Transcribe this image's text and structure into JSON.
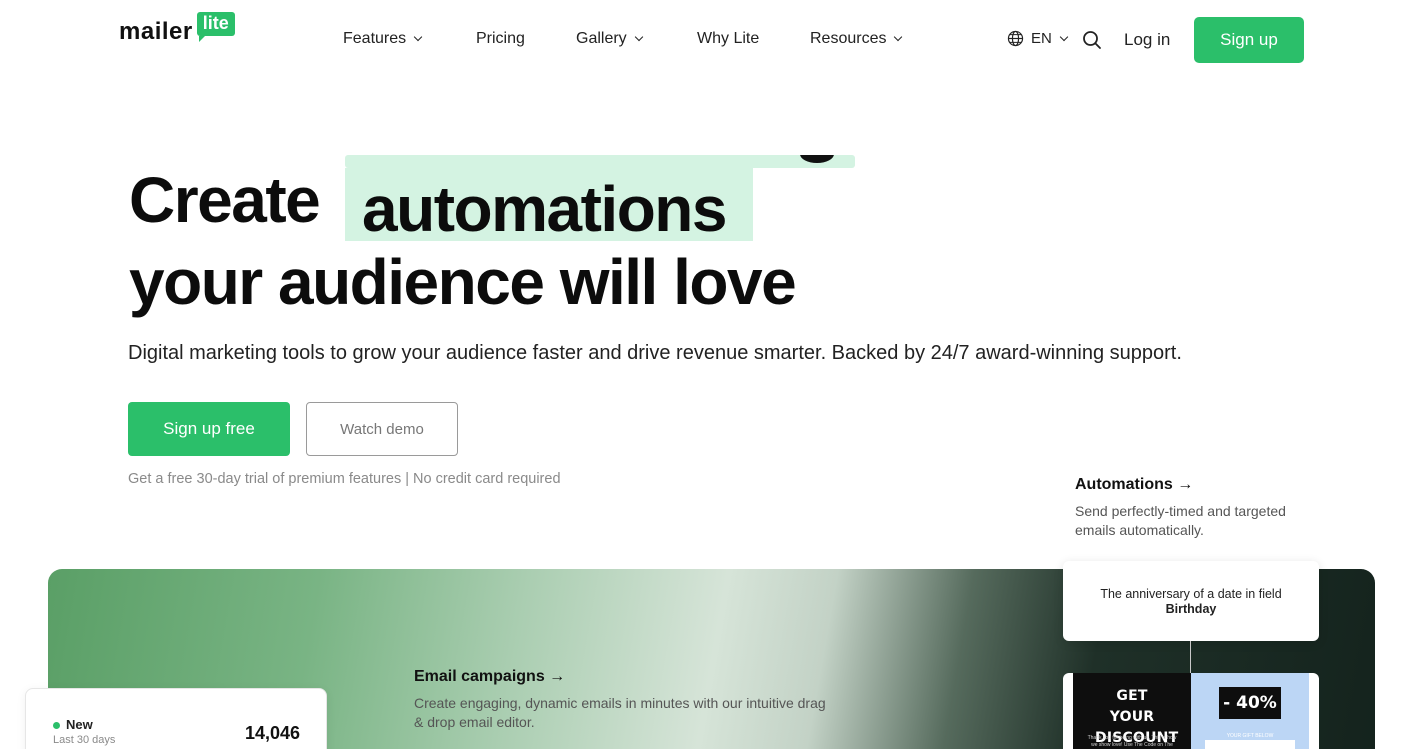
{
  "logo": {
    "word": "mailer",
    "bubble": "lite"
  },
  "nav": {
    "items": [
      {
        "label": "Features",
        "dropdown": true
      },
      {
        "label": "Pricing",
        "dropdown": false
      },
      {
        "label": "Gallery",
        "dropdown": true
      },
      {
        "label": "Why Lite",
        "dropdown": false
      },
      {
        "label": "Resources",
        "dropdown": true
      }
    ],
    "language": "EN",
    "login_label": "Log in",
    "signup_label": "Sign up"
  },
  "hero": {
    "word_create": "Create",
    "word_rotating": "automations",
    "line2": "your audience will love",
    "subtitle": "Digital marketing tools to grow your audience faster and drive revenue smarter. Backed by 24/7 award-winning support.",
    "cta_primary": "Sign up free",
    "cta_secondary": "Watch demo",
    "trial_note": "Get a free 30-day trial of premium features | No credit card required"
  },
  "features": {
    "automations": {
      "title": "Automations →",
      "description": "Send perfectly-timed and targeted emails automatically."
    },
    "email_campaigns": {
      "title": "Email campaigns →",
      "description": "Create engaging, dynamic emails in minutes with our intuitive drag & drop email editor."
    }
  },
  "automation_card": {
    "text": "The anniversary of a date in field",
    "field": "Birthday"
  },
  "email_preview": {
    "headline": "GET YOUR DISCOUNT",
    "small_text": "Thank you for being with us. This is how we show love! Use The Code on The",
    "badge": "- 40%",
    "mini_text": "YOUR GIFT BELOW"
  },
  "stats_card": {
    "label": "New",
    "sublabel": "Last 30 days",
    "value": "14,046"
  },
  "colors": {
    "brand_green": "#2bbf6a",
    "highlight": "#d4f3e2"
  }
}
